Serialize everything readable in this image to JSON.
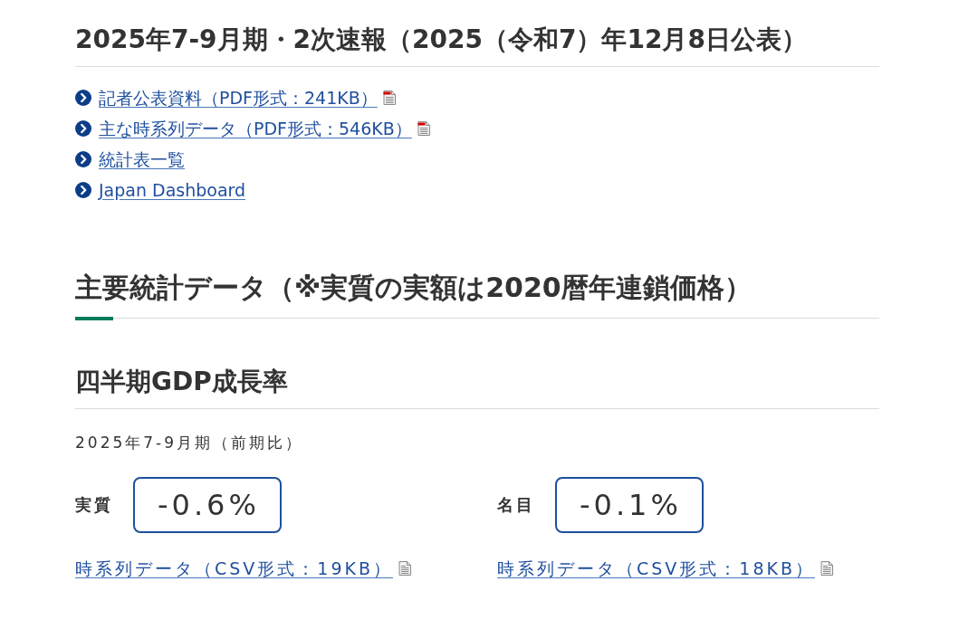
{
  "release": {
    "title": "2025年7-9月期・2次速報（2025（令和7）年12月8日公表）",
    "links": [
      {
        "text": "記者公表資料（PDF形式：241KB）",
        "kind": "pdf"
      },
      {
        "text": "主な時系列データ（PDF形式：546KB）",
        "kind": "pdf"
      },
      {
        "text": "統計表一覧",
        "kind": "page"
      },
      {
        "text": "Japan Dashboard",
        "kind": "page"
      }
    ]
  },
  "main_statistics": {
    "title": "主要統計データ（※実質の実額は2020暦年連鎖価格）",
    "gdp_growth": {
      "title": "四半期GDP成長率",
      "period": "2025年7-9月期（前期比）",
      "metrics": [
        {
          "label": "実質",
          "value": "-0.6%",
          "link": {
            "text": "時系列データ（CSV形式：19KB）",
            "kind": "csv"
          }
        },
        {
          "label": "名目",
          "value": "-0.1%",
          "link": {
            "text": "時系列データ（CSV形式：18KB）",
            "kind": "csv"
          }
        }
      ]
    }
  }
}
